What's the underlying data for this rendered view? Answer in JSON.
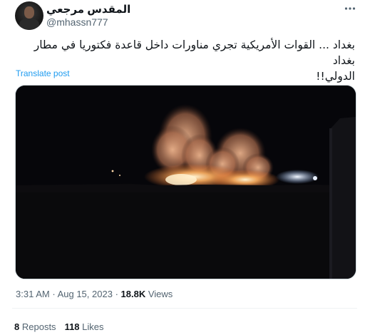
{
  "author": {
    "display_name": "المقدس مرجعي",
    "handle": "@mhassn777"
  },
  "tweet": {
    "text_line1": "بغداد ... القوات الأمريكية تجري مناورات داخل قاعدة فكتوريا في مطار بغداد",
    "text_line2": "الدولي!!",
    "translate_label": "Translate post"
  },
  "meta": {
    "time": "3:31 AM",
    "separator": "·",
    "date": "Aug 15, 2023",
    "views_count": "18.8K",
    "views_label": "Views"
  },
  "stats": {
    "reposts_count": "8",
    "reposts_label": "Reposts",
    "likes_count": "118",
    "likes_label": "Likes"
  },
  "icons": {
    "more": "more-icon"
  }
}
